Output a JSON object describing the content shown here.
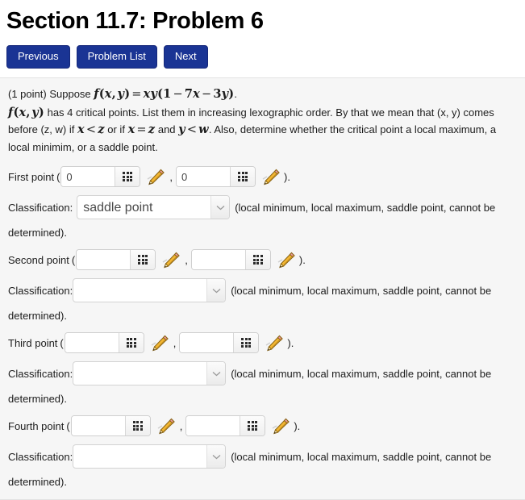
{
  "header": {
    "title": "Section 11.7: Problem 6"
  },
  "nav": {
    "buttons": [
      {
        "label": "Previous",
        "name": "previous-button"
      },
      {
        "label": "Problem List",
        "name": "problem-list-button"
      },
      {
        "label": "Next",
        "name": "next-button"
      }
    ],
    "accent_color": "#1a3494"
  },
  "problem": {
    "points_text": "(1 point)",
    "suppose_text": "Suppose",
    "function_def": "f(x, y) = xy(1 − 7x − 3y).",
    "line2_prefix": "f(x, y)",
    "line2_text": "has 4 critical points. List them in increasing lexographic order. By that we mean that (x, y) comes before (z, w) if",
    "ineq1": "x < z",
    "mid_text": "or if",
    "ineq2": "x = z",
    "and_text": "and",
    "ineq3": "y < w",
    "tail_text": ". Also, determine whether the critical point a local maximum, a local minimim, or a saddle point."
  },
  "answers": {
    "hint": "(local minimum, local maximum, saddle point, cannot be",
    "hint_continued": "determined).",
    "classification_label": "Classification:",
    "open_paren": "(",
    "close_paren": ").",
    "comma": ",",
    "input_placeholder": "",
    "rows": [
      {
        "label": "First point",
        "x_value": "0",
        "y_value": "0",
        "classification": "saddle point"
      },
      {
        "label": "Second point",
        "x_value": "",
        "y_value": "",
        "classification": ""
      },
      {
        "label": "Third point",
        "x_value": "",
        "y_value": "",
        "classification": ""
      },
      {
        "label": "Fourth point",
        "x_value": "",
        "y_value": "",
        "classification": ""
      }
    ],
    "classification_options": [
      "",
      "local minimum",
      "local maximum",
      "saddle point",
      "cannot be determined"
    ]
  },
  "icons": {
    "keypad": "keypad-grid-icon",
    "pencil": "pencil-icon",
    "chevron": "chevron-down-icon"
  }
}
